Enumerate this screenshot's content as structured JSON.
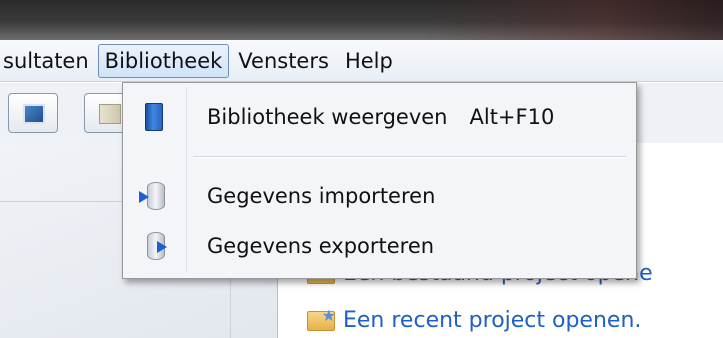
{
  "menubar": {
    "items": [
      "sultaten",
      "Bibliotheek",
      "Vensters",
      "Help"
    ],
    "open_index": 1
  },
  "dropdown": {
    "items": [
      {
        "label": "Bibliotheek weergeven",
        "shortcut": "Alt+F10",
        "icon": "library-book-icon"
      },
      {
        "label": "Gegevens importeren",
        "shortcut": "",
        "icon": "database-import-icon"
      },
      {
        "label": "Gegevens exporteren",
        "shortcut": "",
        "icon": "database-export-icon"
      }
    ]
  },
  "start_page": {
    "links": [
      {
        "label": "Een bestaand project opene",
        "icon": "folder-icon"
      },
      {
        "label": "Een recent project openen.",
        "icon": "folder-recent-icon"
      }
    ]
  },
  "colors": {
    "link": "#1f5fc6",
    "menu_highlight_border": "#6f8fb5",
    "dropdown_bg": "#f3f5f8"
  }
}
